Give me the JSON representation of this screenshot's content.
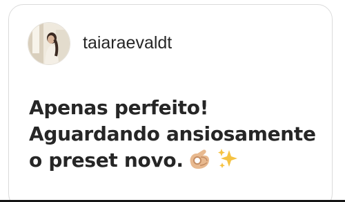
{
  "comment": {
    "username": "taiaraevaldt",
    "avatar_icon": "profile-photo",
    "message_lines": [
      "Apenas perfeito!",
      "Aguardando ansiosamente",
      "o preset novo."
    ],
    "emojis": [
      "ok-hand-icon",
      "sparkles-icon"
    ]
  },
  "colors": {
    "text": "#262626",
    "card_border": "#dadada",
    "sparkles": "#f5c242",
    "hand": "#e8b98f"
  }
}
